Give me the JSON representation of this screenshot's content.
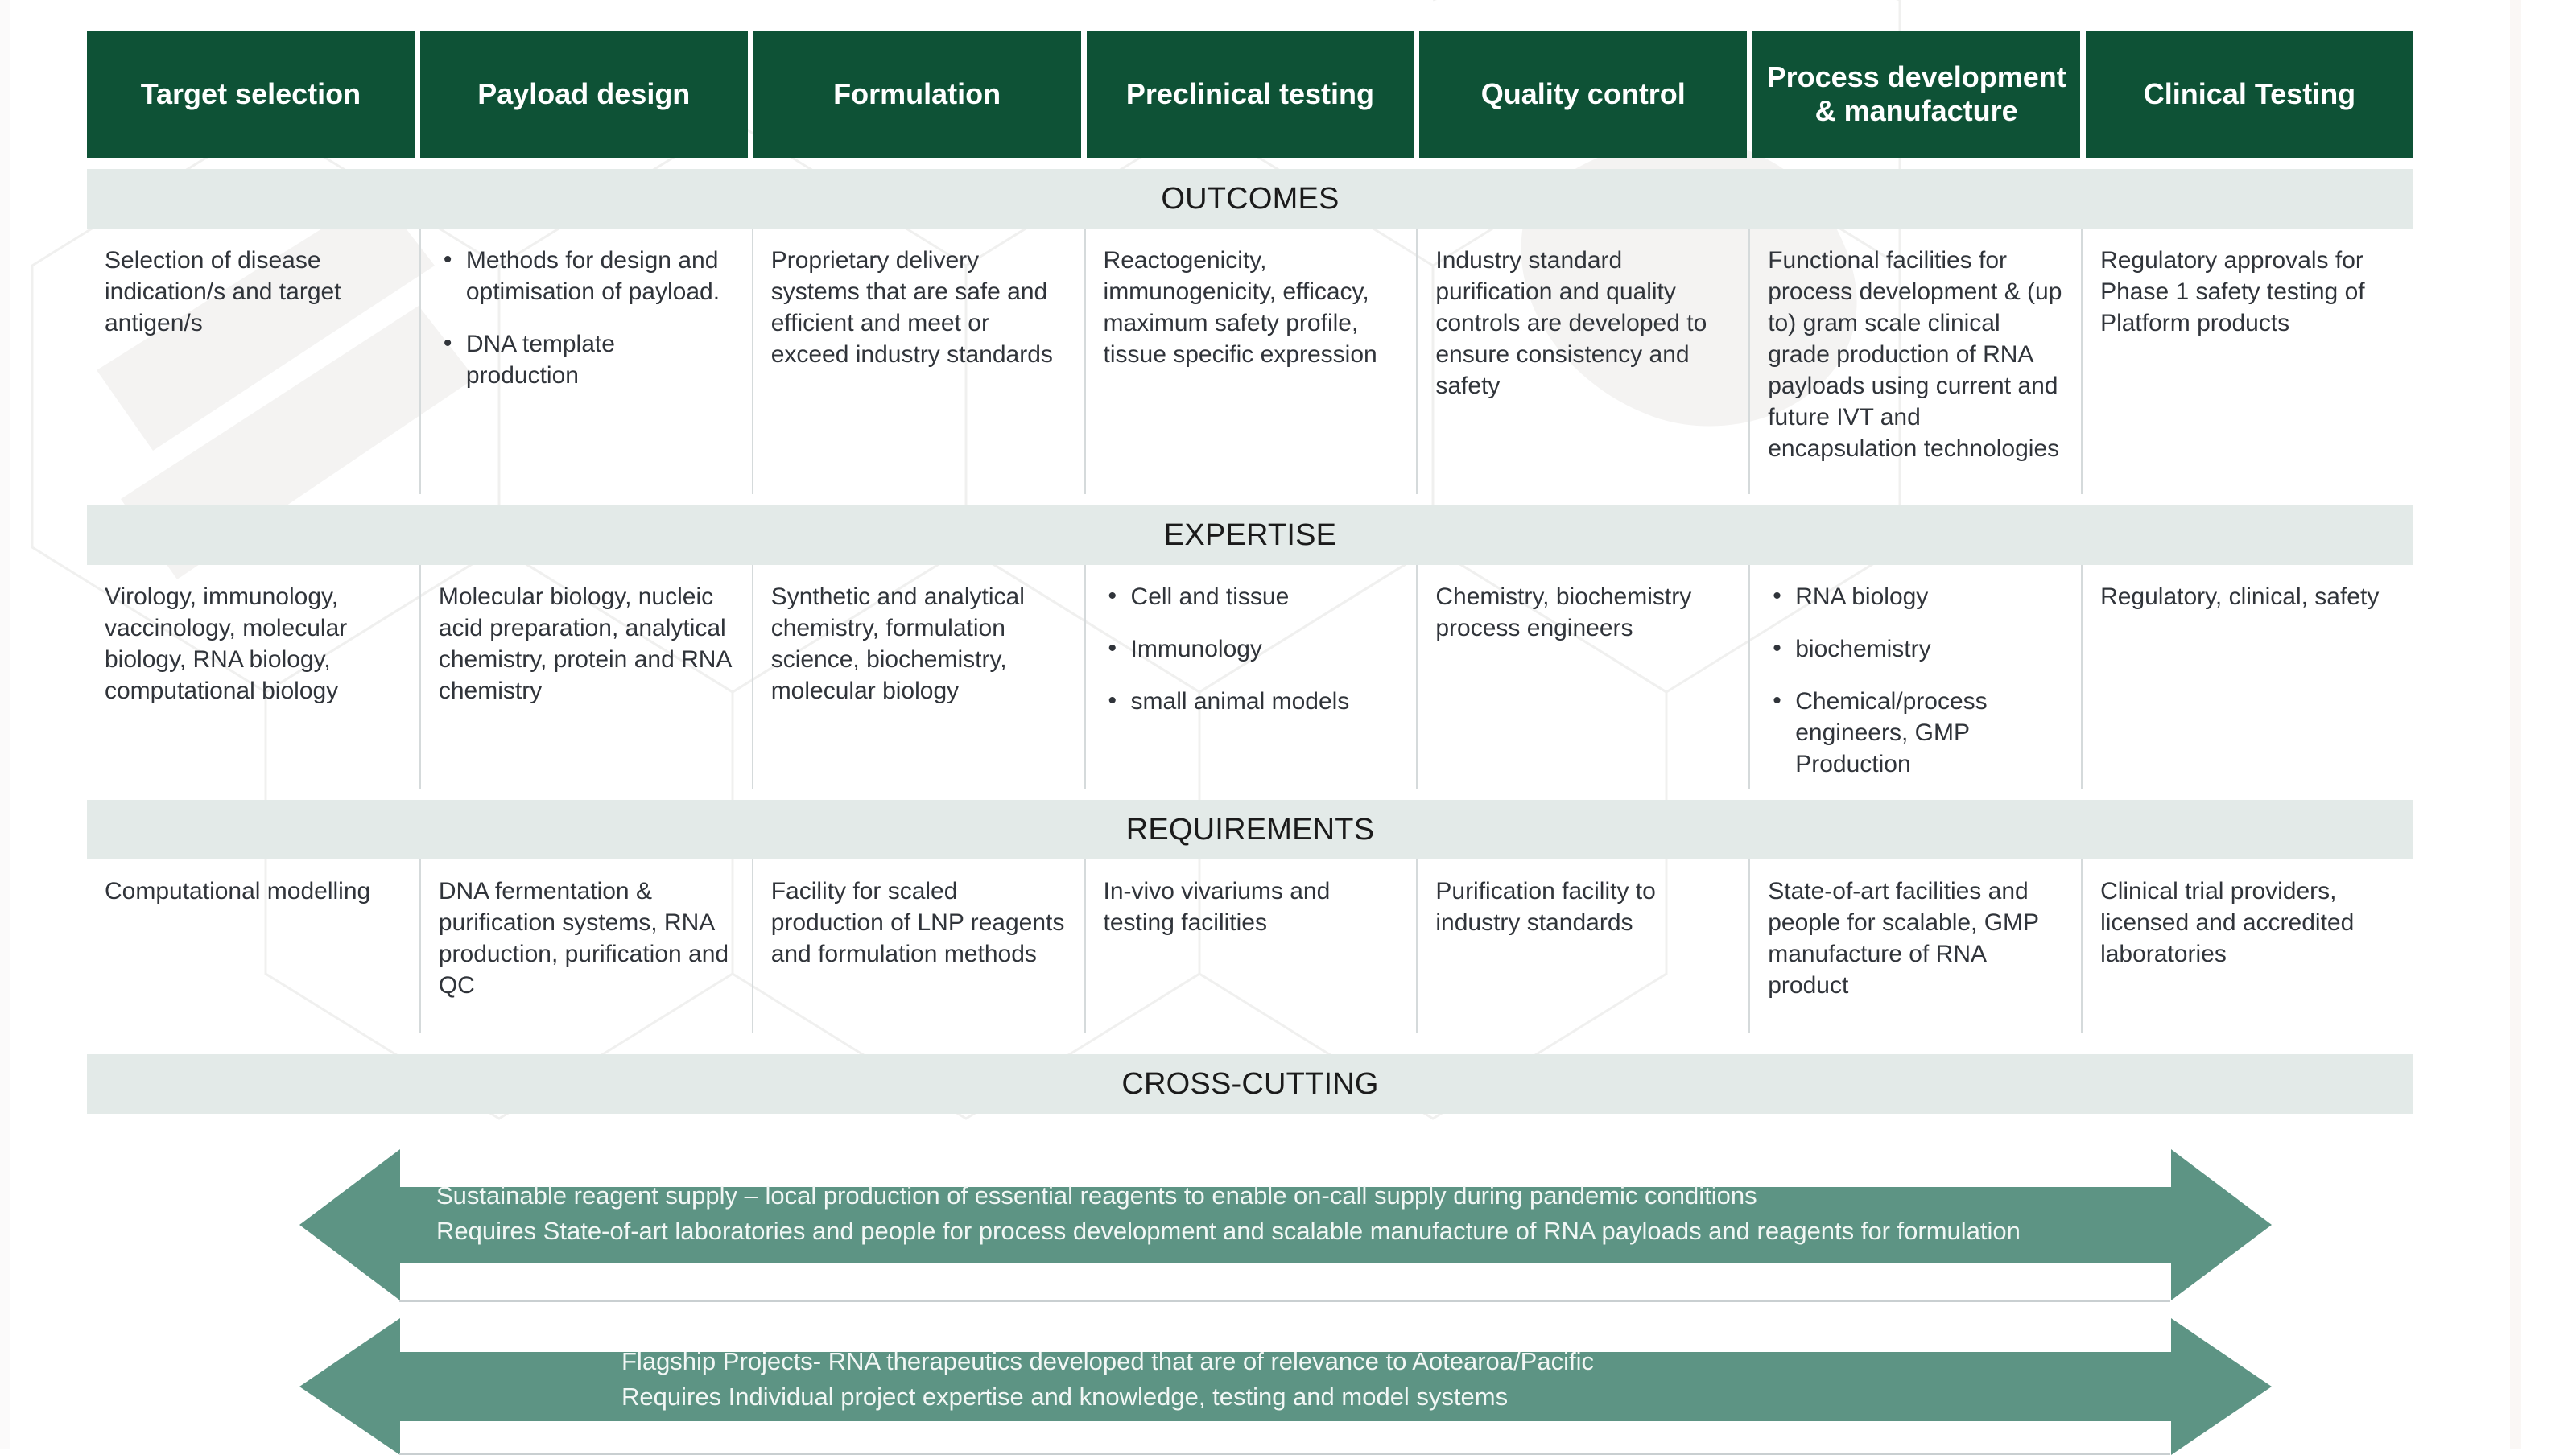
{
  "colors": {
    "header_green": "#0e5236",
    "section_bar": "#e3eae8",
    "arrow_teal": "#5d9484",
    "body_text": "#30343a",
    "rule": "#d5dadb"
  },
  "columns": [
    "Target selection",
    "Payload design",
    "Formulation",
    "Preclinical testing",
    "Quality control",
    "Process development & manufacture",
    "Clinical Testing"
  ],
  "sections": [
    {
      "title": "OUTCOMES",
      "cells": [
        {
          "type": "paragraph",
          "text": "Selection of disease indication/s and target antigen/s"
        },
        {
          "type": "bullets",
          "items": [
            "Methods for design and optimisation of payload.",
            "DNA template production"
          ]
        },
        {
          "type": "paragraph",
          "text": "Proprietary delivery systems that are safe and efficient and meet or exceed industry standards"
        },
        {
          "type": "paragraph",
          "text": "Reactogenicity, immunogenicity, efficacy, maximum safety profile, tissue specific expression"
        },
        {
          "type": "paragraph",
          "text": "Industry standard purification and quality controls are developed to ensure consistency and safety"
        },
        {
          "type": "paragraph",
          "text": "Functional facilities for process development & (up to) gram scale clinical grade production of RNA payloads using current and future IVT and encapsulation technologies"
        },
        {
          "type": "paragraph",
          "text": "Regulatory approvals for Phase 1 safety testing of Platform products"
        }
      ]
    },
    {
      "title": "EXPERTISE",
      "cells": [
        {
          "type": "paragraph",
          "text": "Virology, immunology, vaccinology, molecular biology, RNA biology, computational biology"
        },
        {
          "type": "paragraph",
          "text": "Molecular biology, nucleic acid preparation, analytical chemistry, protein and RNA chemistry"
        },
        {
          "type": "paragraph",
          "text": "Synthetic and analytical chemistry, formulation science, biochemistry, molecular biology"
        },
        {
          "type": "bullets",
          "items": [
            "Cell and tissue",
            "Immunology",
            "small animal models"
          ]
        },
        {
          "type": "paragraph",
          "text": "Chemistry, biochemistry process engineers"
        },
        {
          "type": "bullets",
          "items": [
            "RNA biology",
            "biochemistry",
            "Chemical/process engineers, GMP Production"
          ]
        },
        {
          "type": "paragraph",
          "text": "Regulatory, clinical, safety"
        }
      ]
    },
    {
      "title": "REQUIREMENTS",
      "cells": [
        {
          "type": "paragraph",
          "text": "Computational modelling"
        },
        {
          "type": "paragraph",
          "text": "DNA fermentation & purification systems, RNA production, purification and QC"
        },
        {
          "type": "paragraph",
          "text": "Facility for scaled production of LNP reagents and formulation methods"
        },
        {
          "type": "paragraph",
          "text": "In-vivo vivariums and testing facilities"
        },
        {
          "type": "paragraph",
          "text": "Purification facility to industry standards"
        },
        {
          "type": "paragraph",
          "text": "State-of-art facilities and people for scalable, GMP manufacture of  RNA product"
        },
        {
          "type": "paragraph",
          "text": "Clinical trial providers, licensed and accredited laboratories"
        }
      ]
    }
  ],
  "cross_cutting": {
    "title": "CROSS-CUTTING",
    "arrows": [
      {
        "name": "sustainable-reagent-supply",
        "text": "Sustainable reagent supply – local production of essential reagents to enable on-call supply during pandemic conditions\nRequires State-of-art laboratories and people for  process development and scalable manufacture of RNA payloads and reagents for formulation"
      },
      {
        "name": "flagship-projects",
        "text": "Flagship Projects- RNA therapeutics developed that are of relevance to Aotearoa/Pacific\nRequires Individual project expertise and knowledge, testing and model systems"
      }
    ]
  }
}
